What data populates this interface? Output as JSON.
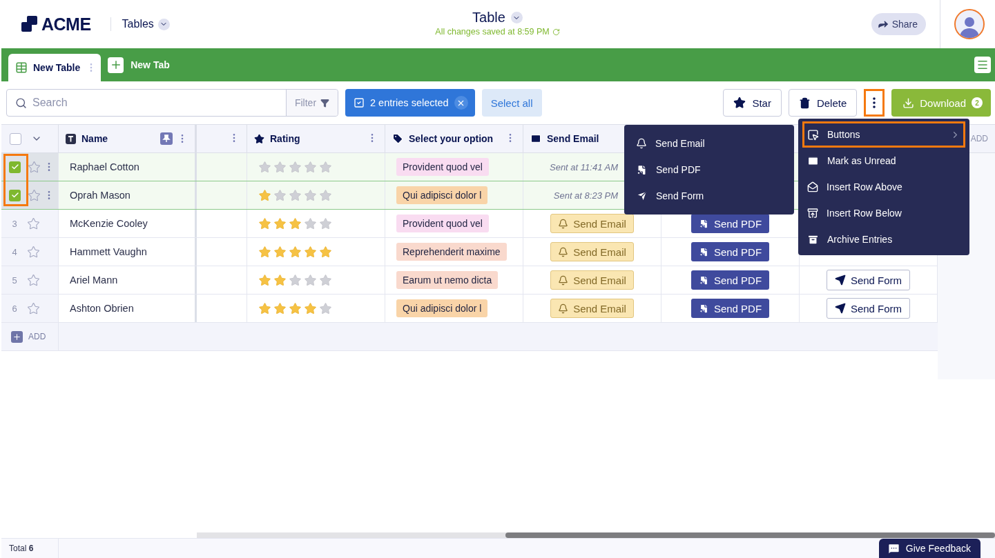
{
  "header": {
    "logo": "ACME",
    "section": "Tables",
    "title": "Table",
    "save_status": "All changes saved at 8:59 PM",
    "share": "Share"
  },
  "tabs": [
    {
      "label": "New Table",
      "selected": true
    }
  ],
  "new_tab": "New Tab",
  "toolbar": {
    "search": {
      "placeholder": "Search"
    },
    "filter": "Filter",
    "selection": "2 entries selected",
    "select_all": "Select all",
    "actions": [
      {
        "kind": "star",
        "label": "Star"
      },
      {
        "kind": "delete",
        "label": "Delete"
      }
    ],
    "more": {
      "highlighted": true
    },
    "download": {
      "label": "Download",
      "count": "2"
    }
  },
  "columns": [
    {
      "kind": "name",
      "label": "Name"
    },
    {
      "kind": "blank"
    },
    {
      "kind": "rating",
      "label": "Rating"
    },
    {
      "kind": "option",
      "label": "Select your option"
    },
    {
      "kind": "email",
      "label": "Send Email"
    }
  ],
  "header_checkbox": {
    "checked": false
  },
  "add_column": "ADD",
  "selection_highlight": true,
  "rows": [
    {
      "selected": true,
      "starred": false,
      "name": "Raphael Cotton",
      "stars": 0,
      "option": {
        "text": "Provident quod vel",
        "color": "#f9dcf1"
      },
      "email": {
        "kind": "sent",
        "text": "Sent at 11:41 AM"
      }
    },
    {
      "selected": true,
      "starred": false,
      "name": "Oprah Mason",
      "stars": 1,
      "option": {
        "text": "Qui adipisci dolor l",
        "color": "#f9d4a8"
      },
      "email": {
        "kind": "sent",
        "text": "Sent at 8:23 PM"
      }
    },
    {
      "selected": false,
      "number": "3",
      "starred": false,
      "name": "McKenzie Cooley",
      "stars": 3,
      "option": {
        "text": "Provident quod vel",
        "color": "#f9dcf1"
      },
      "email": {
        "kind": "button",
        "text": "Send Email"
      },
      "pdf": "Send PDF"
    },
    {
      "selected": false,
      "number": "4",
      "starred": false,
      "name": "Hammett Vaughn",
      "stars": 5,
      "option": {
        "text": "Reprehenderit maxime",
        "color": "#f9d9cd"
      },
      "email": {
        "kind": "button",
        "text": "Send Email"
      },
      "pdf": "Send PDF"
    },
    {
      "selected": false,
      "number": "5",
      "starred": false,
      "name": "Ariel Mann",
      "stars": 2,
      "option": {
        "text": "Earum ut nemo dicta",
        "color": "#f9d9cd"
      },
      "email": {
        "kind": "button",
        "text": "Send Email"
      },
      "pdf": "Send PDF",
      "form": "Send Form"
    },
    {
      "selected": false,
      "number": "6",
      "starred": false,
      "name": "Ashton Obrien",
      "stars": 4,
      "option": {
        "text": "Qui adipisci dolor l",
        "color": "#f9d4a8"
      },
      "email": {
        "kind": "button",
        "text": "Send Email"
      },
      "pdf": "Send PDF",
      "form": "Send Form"
    }
  ],
  "add_row": "ADD",
  "menu": [
    {
      "kind": "buttons",
      "label": "Buttons",
      "highlighted": true
    },
    {
      "kind": "unread",
      "label": "Mark as Unread",
      "highlighted": false
    },
    {
      "kind": "above",
      "label": "Insert Row Above",
      "highlighted": false
    },
    {
      "kind": "below",
      "label": "Insert Row Below",
      "highlighted": false
    },
    {
      "kind": "archive",
      "label": "Archive Entries",
      "highlighted": false
    }
  ],
  "submenu": [
    {
      "kind": "email",
      "label": "Send Email"
    },
    {
      "kind": "pdf",
      "label": "Send PDF"
    },
    {
      "kind": "form",
      "label": "Send Form"
    }
  ],
  "footer": {
    "total": "Total **6**",
    "feedback": "Give Feedback"
  }
}
